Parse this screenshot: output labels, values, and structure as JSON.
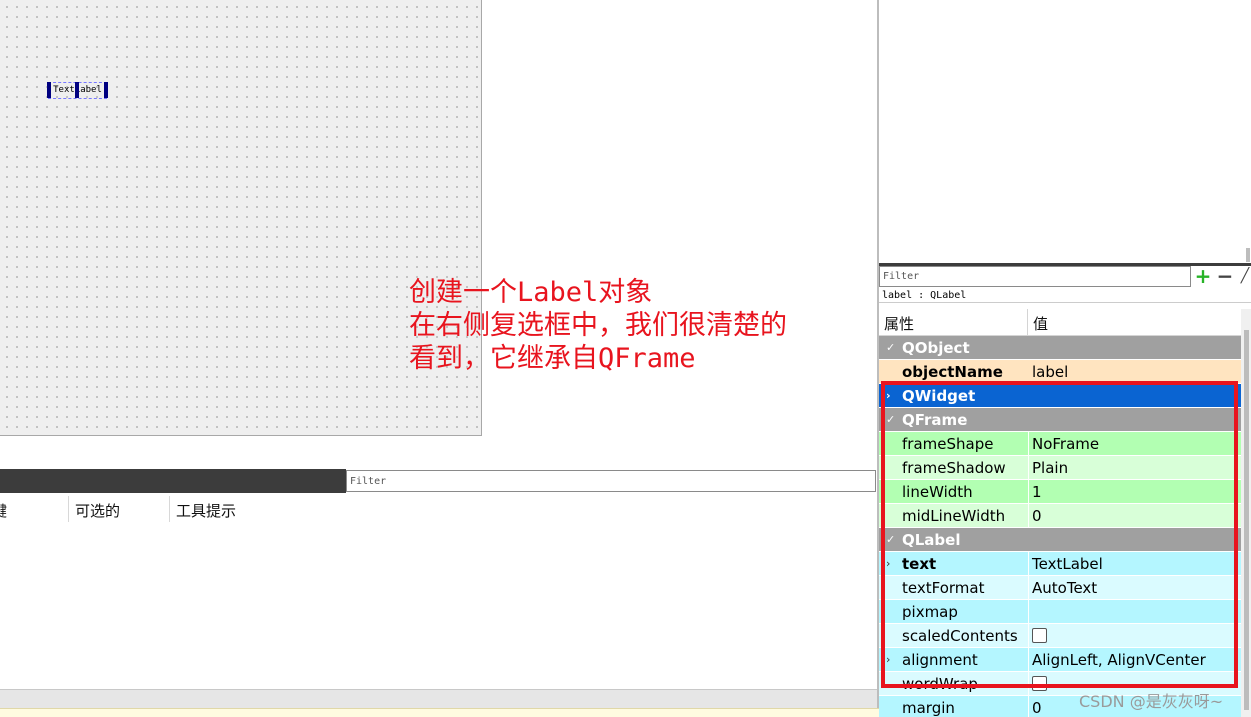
{
  "canvas": {
    "widget_text": "TextLabel"
  },
  "annotation": {
    "line1": "创建一个Label对象",
    "line2": "在右侧复选框中，我们很清楚的",
    "line3": "看到，它继承自QFrame",
    "color": "#e8141e"
  },
  "action_editor": {
    "filter_placeholder": "Filter",
    "columns": [
      "键",
      "可选的",
      "工具提示"
    ]
  },
  "property_editor": {
    "filter_placeholder": "Filter",
    "add_icon": "plus-icon",
    "remove_icon": "minus-icon",
    "configure_icon": "wrench-icon",
    "object_label": "label : QLabel",
    "header_property": "属性",
    "header_value": "值",
    "groups": {
      "qobject": "QObject",
      "qwidget": "QWidget",
      "qframe": "QFrame",
      "qlabel": "QLabel"
    },
    "rows": {
      "objectName": {
        "name": "objectName",
        "value": "label"
      },
      "frameShape": {
        "name": "frameShape",
        "value": "NoFrame"
      },
      "frameShadow": {
        "name": "frameShadow",
        "value": "Plain"
      },
      "lineWidth": {
        "name": "lineWidth",
        "value": "1"
      },
      "midLineWidth": {
        "name": "midLineWidth",
        "value": "0"
      },
      "text": {
        "name": "text",
        "value": "TextLabel"
      },
      "textFormat": {
        "name": "textFormat",
        "value": "AutoText"
      },
      "pixmap": {
        "name": "pixmap",
        "value": ""
      },
      "scaledContents": {
        "name": "scaledContents",
        "checked": false
      },
      "alignment": {
        "name": "alignment",
        "value": "AlignLeft, AlignVCenter"
      },
      "wordWrap": {
        "name": "wordWrap",
        "checked": false
      },
      "margin": {
        "name": "margin",
        "value": "0"
      }
    },
    "colors": {
      "qobject_row": "#ffe4c0",
      "qwidget_group": "#0a64d2",
      "qframe_row": "#b2ffb2",
      "qlabel_row": "#b4f6ff",
      "highlight_box": "#e8141e"
    }
  },
  "watermark": "CSDN @是灰灰呀~"
}
